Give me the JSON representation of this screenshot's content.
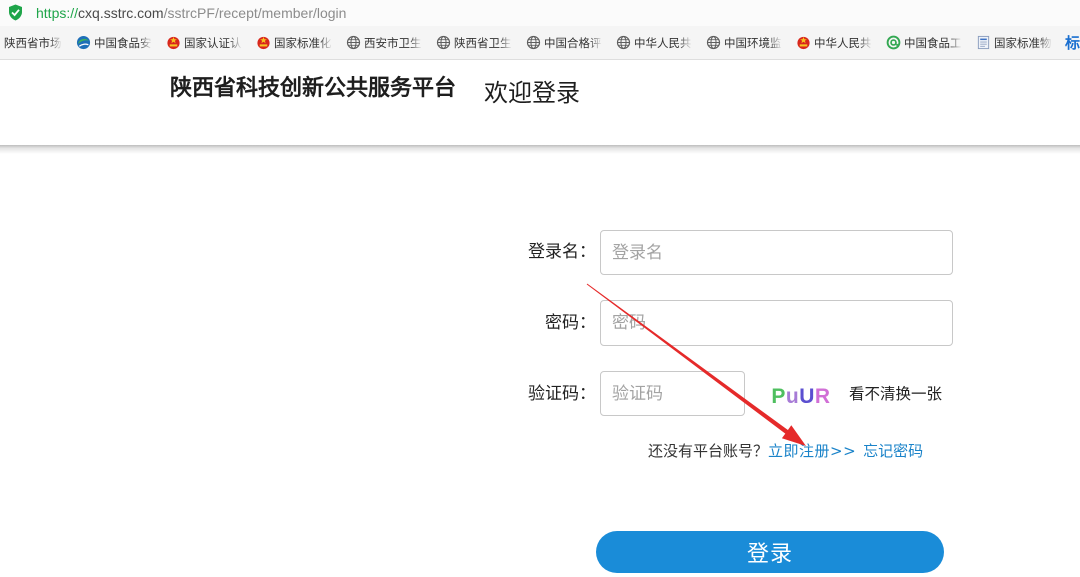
{
  "browser": {
    "url": {
      "scheme": "https://",
      "host": "cxq.sstrc.com",
      "path": "/sstrcPF/recept/member/login"
    },
    "security_icon": "secure-shield-icon",
    "bookmarks": [
      {
        "label": "陕西省市场"
      },
      {
        "label": "中国食品安",
        "icon": "swirl-logo-icon"
      },
      {
        "label": "国家认证认",
        "icon": "national-emblem-icon"
      },
      {
        "label": "国家标准化",
        "icon": "national-emblem-icon"
      },
      {
        "label": "西安市卫生",
        "icon": "globe-icon"
      },
      {
        "label": "陕西省卫生",
        "icon": "globe-icon"
      },
      {
        "label": "中国合格评",
        "icon": "globe-icon"
      },
      {
        "label": "中华人民共",
        "icon": "globe-icon"
      },
      {
        "label": "中国环境监",
        "icon": "globe-icon"
      },
      {
        "label": "中华人民共",
        "icon": "national-emblem-icon"
      },
      {
        "label": "中国食品工",
        "icon": "green-at-icon"
      },
      {
        "label": "国家标准物",
        "icon": "document-icon"
      },
      {
        "icon": "character-logo-icon",
        "icon_text": "标"
      }
    ]
  },
  "header": {
    "site_title": "陕西省科技创新公共服务平台",
    "welcome": "欢迎登录"
  },
  "login": {
    "username": {
      "label": "登录名：",
      "placeholder": "登录名",
      "value": ""
    },
    "password": {
      "label": "密码：",
      "placeholder": "密码",
      "value": ""
    },
    "captcha": {
      "label": "验证码：",
      "placeholder": "验证码",
      "value": "",
      "image_chars": [
        {
          "char": "P",
          "color": "#4fbf5f"
        },
        {
          "char": "u",
          "color": "#a77bd6"
        },
        {
          "char": "U",
          "color": "#5b4fd0"
        },
        {
          "char": "R",
          "color": "#d16fd6"
        }
      ],
      "refresh_link": "看不清换一张"
    },
    "register_prompt": "还没有平台账号？",
    "register_link": "立即注册>>",
    "forgot_link": "忘记密码",
    "submit_label": "登录"
  },
  "colors": {
    "secure_green": "#1fa54a",
    "link_blue": "#1a83c9",
    "button_blue": "#1a8cd8",
    "annotation_red": "#e52a2a"
  }
}
